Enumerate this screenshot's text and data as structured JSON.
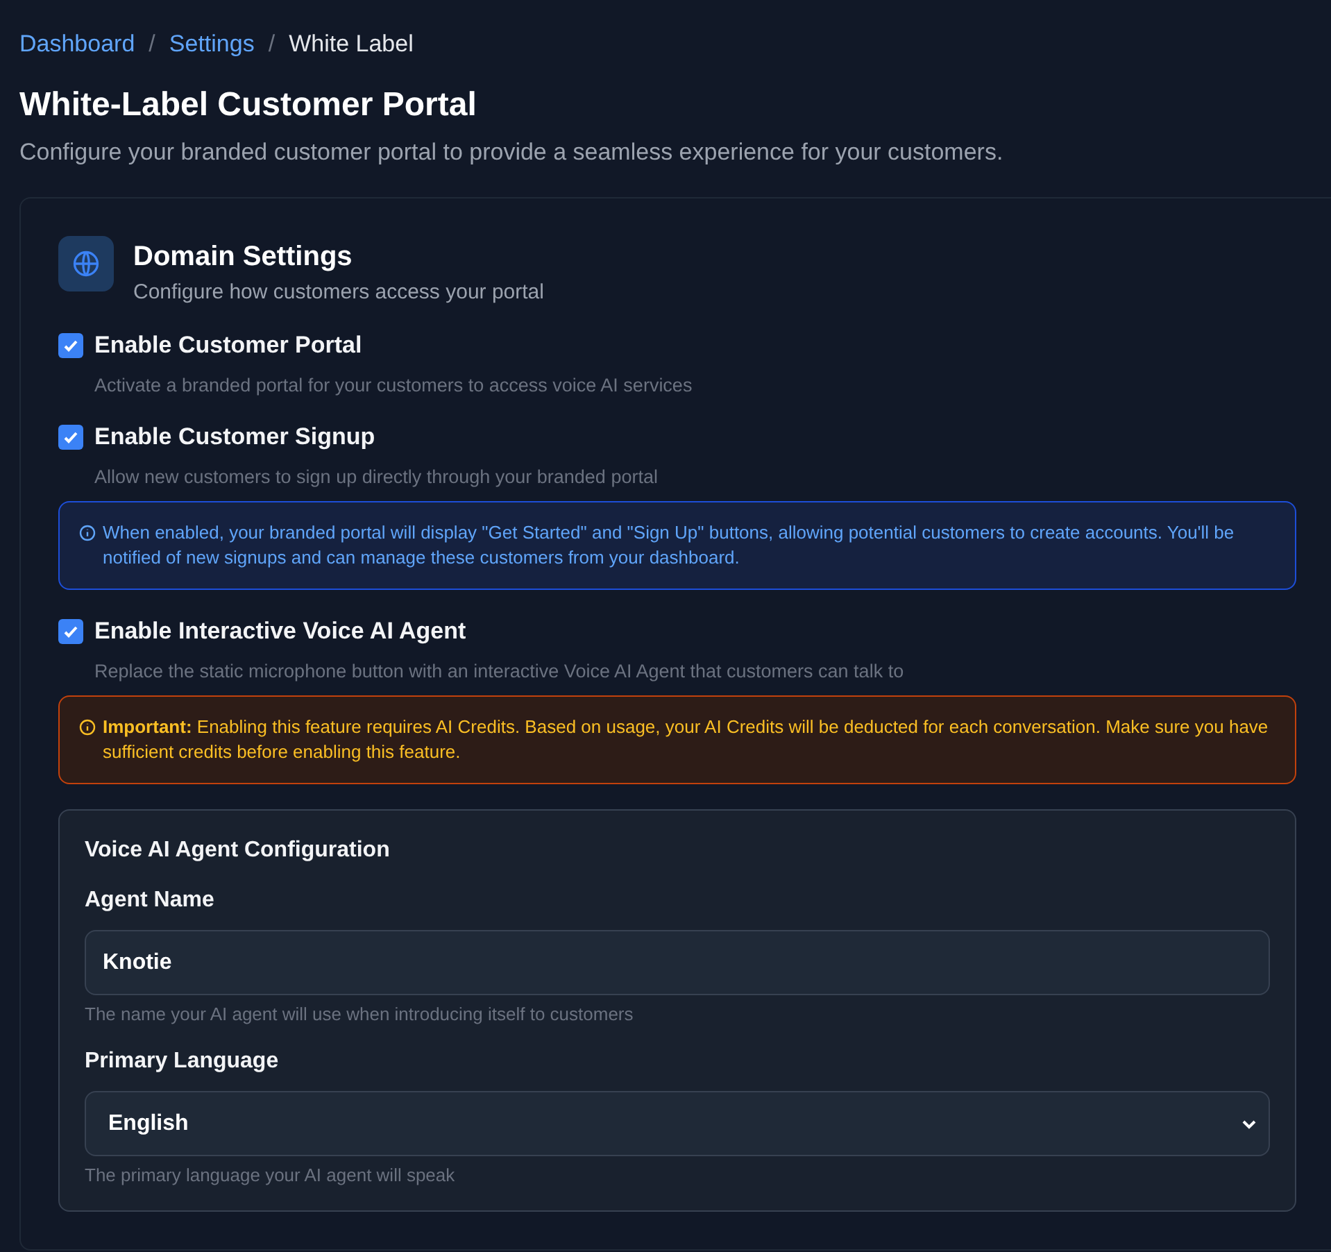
{
  "breadcrumb": [
    {
      "label": "Dashboard",
      "kind": "link"
    },
    {
      "label": "Settings",
      "kind": "link"
    },
    {
      "label": "White Label",
      "kind": "current"
    }
  ],
  "breadcrumb_separator": "/",
  "page": {
    "title": "White-Label Customer Portal",
    "subtitle": "Configure your branded customer portal to provide a seamless experience for your customers."
  },
  "section": {
    "title": "Domain Settings",
    "subtitle": "Configure how customers access your portal"
  },
  "options": [
    {
      "label": "Enable Customer Portal",
      "description": "Activate a branded portal for your customers to access voice AI services",
      "checked": true
    },
    {
      "label": "Enable Customer Signup",
      "description": "Allow new customers to sign up directly through your branded portal",
      "checked": true,
      "notice": {
        "kind": "info",
        "text": "When enabled, your branded portal will display \"Get Started\" and \"Sign Up\" buttons, allowing potential customers to create accounts. You'll be notified of new signups and can manage these customers from your dashboard."
      }
    },
    {
      "label": "Enable Interactive Voice AI Agent",
      "description": "Replace the static microphone button with an interactive Voice AI Agent that customers can talk to",
      "checked": true,
      "notice": {
        "kind": "warning",
        "text": "**Important:** Enabling this feature requires AI Credits. Based on usage, your AI Credits will be deducted for each conversation. Make sure you have sufficient credits before enabling this feature."
      }
    }
  ],
  "agent_config": {
    "title": "Voice AI Agent Configuration",
    "fields": [
      {
        "kind": "text",
        "label": "Agent Name",
        "value": "Knotie",
        "help": "The name your AI agent will use when introducing itself to customers"
      },
      {
        "kind": "select",
        "label": "Primary Language",
        "value": "English",
        "help": "The primary language your AI agent will speak"
      }
    ]
  }
}
